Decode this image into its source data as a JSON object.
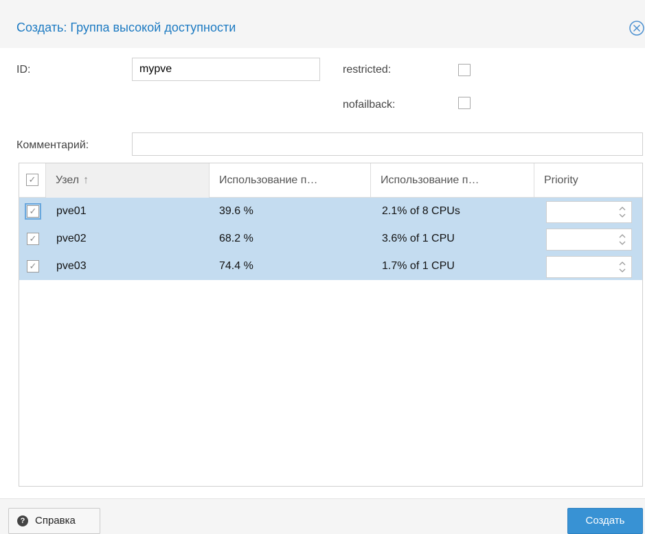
{
  "dialog": {
    "title": "Создать: Группа высокой доступности"
  },
  "form": {
    "id_label": "ID:",
    "id_value": "mypve",
    "restricted_label": "restricted:",
    "restricted_checked": false,
    "nofailback_label": "nofailback:",
    "nofailback_checked": false,
    "comment_label": "Комментарий:",
    "comment_value": ""
  },
  "grid": {
    "columns": [
      "Узел",
      "Использование п…",
      "Использование п…",
      "Priority"
    ],
    "sort_column": "Узел",
    "sort_direction": "ascending",
    "rows": [
      {
        "node": "pve01",
        "mem": "39.6 %",
        "cpu": "2.1% of 8 CPUs",
        "selected": true,
        "priority": ""
      },
      {
        "node": "pve02",
        "mem": "68.2 %",
        "cpu": "3.6% of 1 CPU",
        "selected": true,
        "priority": ""
      },
      {
        "node": "pve03",
        "mem": "74.4 %",
        "cpu": "1.7% of 1 CPU",
        "selected": true,
        "priority": ""
      }
    ]
  },
  "footer": {
    "help_label": "Справка",
    "create_label": "Создать"
  },
  "colors": {
    "accent": "#1c7ac2",
    "selected_row": "#c4dcf0",
    "primary_button": "#3892d4"
  },
  "icons": [
    "close-icon",
    "checkbox-icon",
    "arrow-up-icon",
    "stepper-icon",
    "question-icon"
  ]
}
